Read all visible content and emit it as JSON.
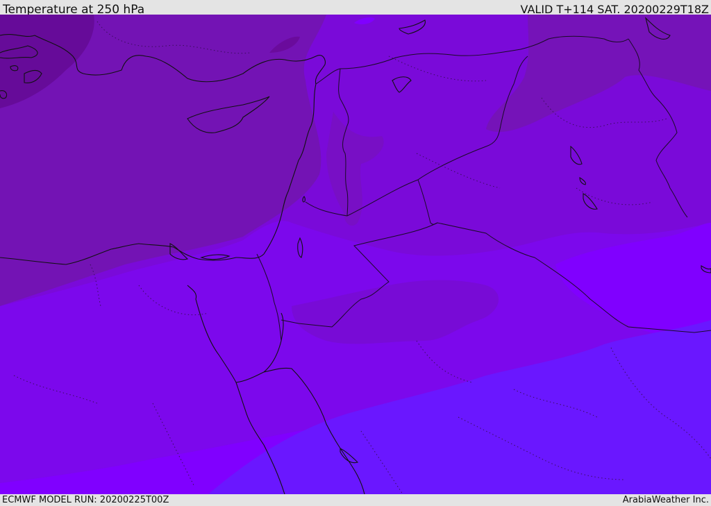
{
  "header": {
    "title": "Temperature at 250 hPa",
    "valid": "VALID T+114 SAT. 20200229T18Z"
  },
  "footer": {
    "model_run": "ECMWF MODEL RUN: 20200225T00Z",
    "brand": "ArabiaWeather Inc."
  },
  "map": {
    "variable": "temperature",
    "level": "250 hPa",
    "colors": {
      "darkest": "#6a0a9e",
      "dark": "#7613b3",
      "mid_dark": "#7b0ad6",
      "mid": "#7f08f2",
      "bright": "#8000ff",
      "blue": "#6a17ff",
      "coastline": "#111111",
      "border": "#2a0b3b"
    }
  }
}
